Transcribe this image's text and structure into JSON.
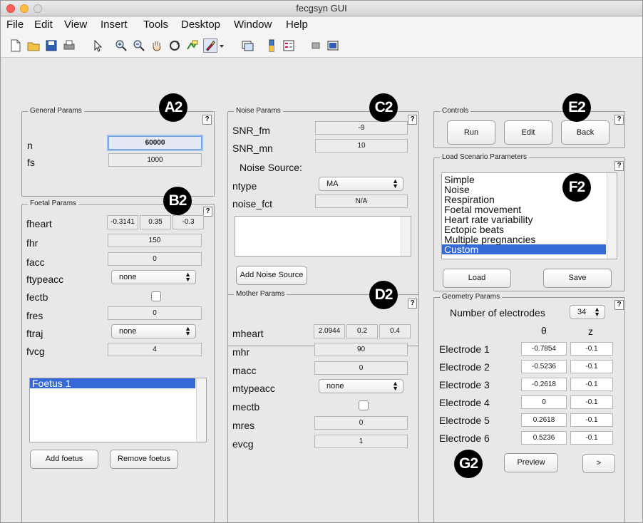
{
  "window": {
    "title": "fecgsyn GUI"
  },
  "menu": [
    "File",
    "Edit",
    "View",
    "Insert",
    "Tools",
    "Desktop",
    "Window",
    "Help"
  ],
  "toolbar_icons": [
    "new-file-icon",
    "open-folder-icon",
    "save-icon",
    "print-icon",
    "pointer-icon",
    "zoom-in-icon",
    "zoom-out-icon",
    "pan-hand-icon",
    "rotate-3d-icon",
    "data-cursor-icon",
    "brush-icon",
    "brush-menu-arrow-icon",
    "link-plot-icon",
    "colorbar-icon",
    "legend-icon",
    "hide-plot-tools-icon",
    "show-plot-tools-icon"
  ],
  "badges": {
    "a": "A2",
    "b": "B2",
    "c": "C2",
    "d": "D2",
    "e": "E2",
    "f": "F2",
    "g": "G2"
  },
  "help_label": "?",
  "general": {
    "title": "General Params",
    "rows": [
      {
        "label": "n",
        "value": "60000"
      },
      {
        "label": "fs",
        "value": "1000"
      }
    ]
  },
  "foetal": {
    "title": "Foetal Params",
    "fheart": {
      "label": "fheart",
      "values": [
        "-0.3141",
        "0.35",
        "-0.3"
      ]
    },
    "fhr": {
      "label": "fhr",
      "value": "150"
    },
    "facc": {
      "label": "facc",
      "value": "0"
    },
    "ftypeacc": {
      "label": "ftypeacc",
      "selected": "none"
    },
    "fectb": {
      "label": "fectb",
      "checked": false
    },
    "fres": {
      "label": "fres",
      "value": "0"
    },
    "ftraj": {
      "label": "ftraj",
      "selected": "none"
    },
    "fvcg": {
      "label": "fvcg",
      "value": "4"
    },
    "list": [
      "Foetus 1"
    ],
    "list_selected": 0,
    "add_label": "Add foetus",
    "remove_label": "Remove foetus"
  },
  "noise": {
    "title": "Noise Params",
    "snr_fm": {
      "label": "SNR_fm",
      "value": "-9"
    },
    "snr_mn": {
      "label": "SNR_mn",
      "value": "10"
    },
    "source_label": "Noise Source:",
    "ntype": {
      "label": "ntype",
      "selected": "MA"
    },
    "noise_fct": {
      "label": "noise_fct",
      "value": "N/A"
    },
    "add_label": "Add Noise Source"
  },
  "mother": {
    "title": "Mother Params",
    "mheart": {
      "label": "mheart",
      "values": [
        "2.0944",
        "0.2",
        "0.4"
      ]
    },
    "mhr": {
      "label": "mhr",
      "value": "90"
    },
    "macc": {
      "label": "macc",
      "value": "0"
    },
    "mtypeacc": {
      "label": "mtypeacc",
      "selected": "none"
    },
    "mectb": {
      "label": "mectb",
      "checked": false
    },
    "mres": {
      "label": "mres",
      "value": "0"
    },
    "evcg": {
      "label": "evcg",
      "value": "1"
    }
  },
  "controls": {
    "title": "Controls",
    "run": "Run",
    "edit": "Edit",
    "back": "Back"
  },
  "scenario": {
    "title": "Load Scenario Parameters",
    "items": [
      "Simple",
      "Noise",
      "Respiration",
      "Foetal movement",
      "Heart rate variability",
      "Ectopic beats",
      "Multiple pregnancies",
      "Custom"
    ],
    "selected_index": 7,
    "load": "Load",
    "save": "Save"
  },
  "geometry": {
    "title": "Geometry Params",
    "num_label": "Number of electrodes",
    "num_value": "34",
    "theta_header": "θ",
    "z_header": "z",
    "electrodes": [
      {
        "label": "Electrode 1",
        "theta": "-0.7854",
        "z": "-0.1"
      },
      {
        "label": "Electrode 2",
        "theta": "-0.5236",
        "z": "-0.1"
      },
      {
        "label": "Electrode 3",
        "theta": "-0.2618",
        "z": "-0.1"
      },
      {
        "label": "Electrode 4",
        "theta": "0",
        "z": "-0.1"
      },
      {
        "label": "Electrode 5",
        "theta": "0.2618",
        "z": "-0.1"
      },
      {
        "label": "Electrode 6",
        "theta": "0.5236",
        "z": "-0.1"
      }
    ],
    "preview": "Preview",
    "next": ">"
  },
  "colors": {
    "selection": "#3569d6",
    "badge": "#000000",
    "field_bg": "#ececec"
  }
}
